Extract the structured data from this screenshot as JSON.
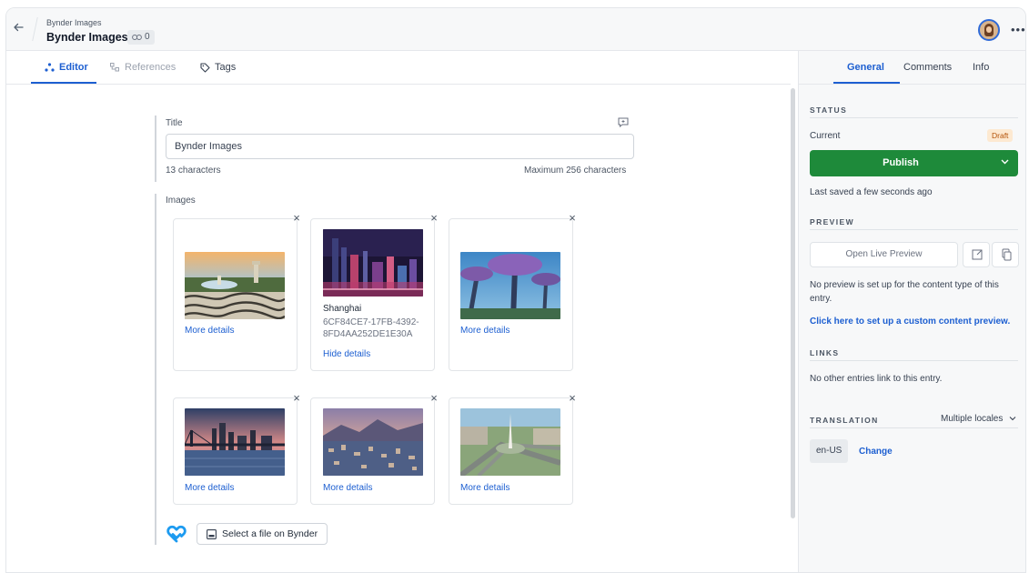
{
  "header": {
    "breadcrumb": "Bynder Images",
    "title": "Bynder Images",
    "reference_count": "0"
  },
  "editor_tabs": [
    {
      "label": "Editor",
      "active": true
    },
    {
      "label": "References",
      "active": false
    },
    {
      "label": "Tags",
      "active": false
    }
  ],
  "title_field": {
    "label": "Title",
    "value": "Bynder Images",
    "char_count": "13 characters",
    "char_limit": "Maximum 256 characters"
  },
  "images_field": {
    "label": "Images",
    "cards": [
      {
        "scene": "fountain-plaza",
        "link": "More details"
      },
      {
        "scene": "shanghai-night",
        "name": "Shanghai",
        "id_line1": "6CF84CE7-17FB-4392-",
        "id_line2": "8FD4AA252DE1E30A",
        "link": "Hide details"
      },
      {
        "scene": "supertrees",
        "link": "More details"
      },
      {
        "scene": "bridge-skyline",
        "link": "More details"
      },
      {
        "scene": "city-hills",
        "link": "More details"
      },
      {
        "scene": "obelisk-square",
        "link": "More details"
      }
    ],
    "select_button": "Select a file on Bynder"
  },
  "sidebar": {
    "tabs": [
      {
        "label": "General",
        "active": true
      },
      {
        "label": "Comments",
        "active": false
      },
      {
        "label": "Info",
        "active": false
      }
    ],
    "status": {
      "heading": "STATUS",
      "current_label": "Current",
      "badge": "Draft",
      "publish_label": "Publish",
      "last_saved": "Last saved a few seconds ago"
    },
    "preview": {
      "heading": "PREVIEW",
      "open_button": "Open Live Preview",
      "note": "No preview is set up for the content type of this entry.",
      "setup_link": "Click here to set up a custom content preview."
    },
    "links": {
      "heading": "LINKS",
      "note": "No other entries link to this entry."
    },
    "translation": {
      "heading": "TRANSLATION",
      "selector": "Multiple locales",
      "locale": "en-US",
      "change_link": "Change"
    }
  },
  "colors": {
    "accent": "#1d5fd1",
    "publish": "#1e8a3a",
    "draft_bg": "#fde9d1",
    "draft_text": "#b45309",
    "bynder_logo": "#1d9bf0"
  }
}
